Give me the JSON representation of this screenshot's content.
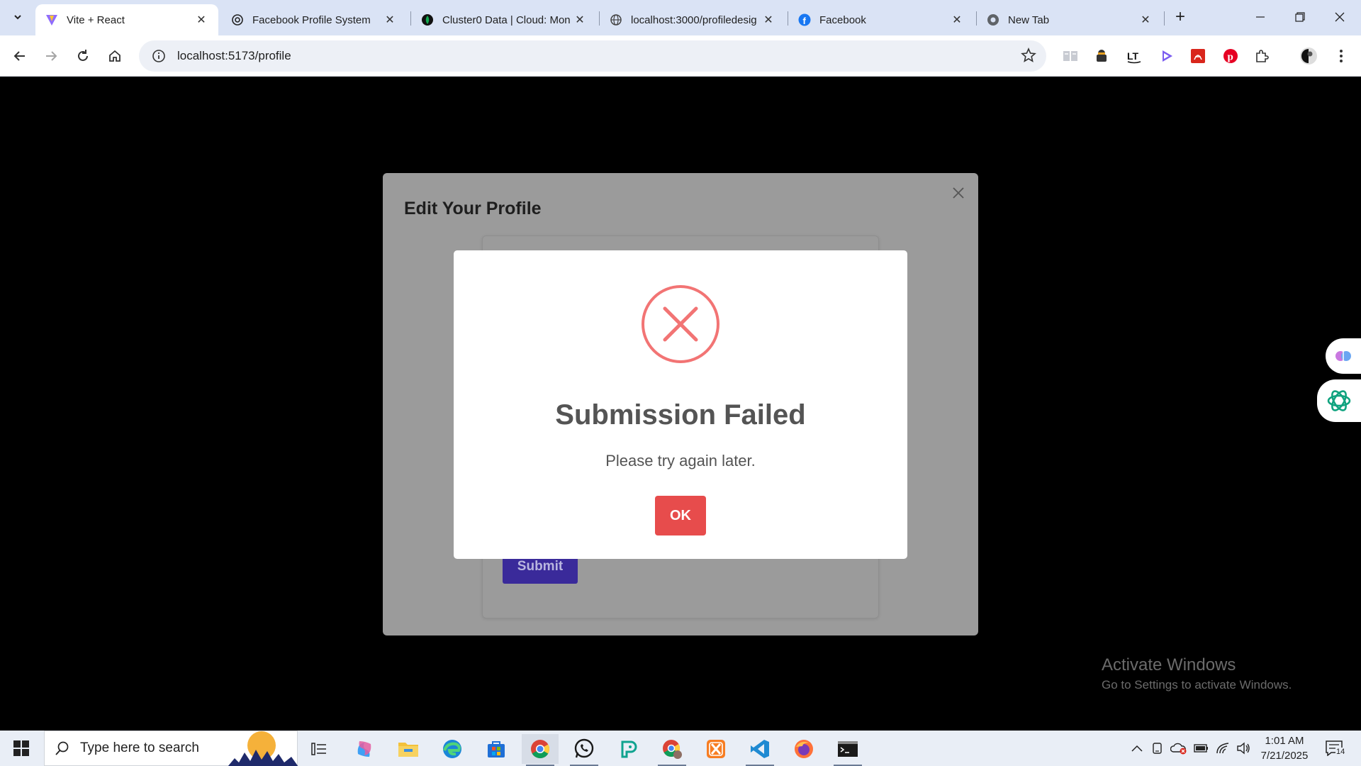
{
  "browser": {
    "tabs": [
      {
        "title": "Vite + React",
        "active": true,
        "icon": "vite-icon"
      },
      {
        "title": "Facebook Profile System",
        "active": false,
        "icon": "openai-icon"
      },
      {
        "title": "Cluster0 Data | Cloud: Mon",
        "active": false,
        "icon": "mongodb-icon"
      },
      {
        "title": "localhost:3000/profiledesig",
        "active": false,
        "icon": "globe-icon"
      },
      {
        "title": "Facebook",
        "active": false,
        "icon": "facebook-icon"
      },
      {
        "title": "New Tab",
        "active": false,
        "icon": "chrome-icon"
      }
    ],
    "url": "localhost:5173/profile"
  },
  "edit_modal": {
    "title": "Edit Your Profile",
    "submit_label": "Submit"
  },
  "alert": {
    "title": "Submission Failed",
    "message": "Please try again later.",
    "ok_label": "OK",
    "icon": "error-x-icon",
    "accent": "#f27474",
    "button_color": "#e74c4c"
  },
  "watermark": {
    "line1": "Activate Windows",
    "line2": "Go to Settings to activate Windows."
  },
  "taskbar": {
    "search_placeholder": "Type here to search",
    "time": "1:01 AM",
    "date": "7/21/2025",
    "notification_count": "14"
  }
}
